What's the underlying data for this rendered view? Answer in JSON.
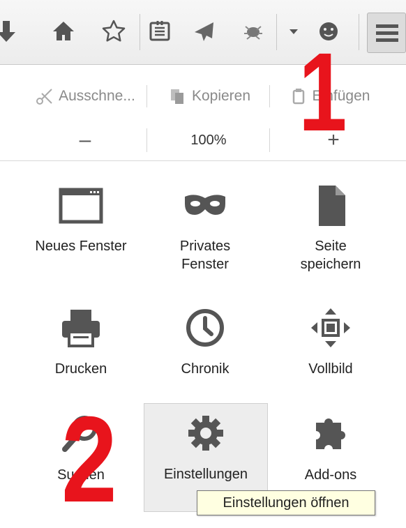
{
  "toolbar": {
    "icons": [
      "download-arrow-icon",
      "home-icon",
      "bookmark-star-icon",
      "reading-list-icon",
      "send-tab-icon",
      "addon-bug-icon",
      "dropdown-arrow-icon",
      "smiley-icon",
      "hamburger-menu-icon"
    ]
  },
  "edit": {
    "cut_label": "Ausschne...",
    "copy_label": "Kopieren",
    "paste_label": "Einfügen"
  },
  "zoom": {
    "minus": "–",
    "value": "100%",
    "plus": "+"
  },
  "grid": {
    "new_window": "Neues Fenster",
    "private_window_line1": "Privates",
    "private_window_line2": "Fenster",
    "save_page_line1": "Seite",
    "save_page_line2": "speichern",
    "print": "Drucken",
    "history": "Chronik",
    "fullscreen": "Vollbild",
    "find": "Suchen",
    "options": "Einstellungen",
    "addons": "Add-ons"
  },
  "tooltip": {
    "text": "Einstellungen öffnen"
  },
  "annotations": {
    "step1": "1",
    "step2": "2"
  },
  "colors": {
    "annotation_red": "#e8141c",
    "toolbar_bg": "#f0f0f0",
    "hover_bg": "#ededed",
    "tooltip_bg": "#ffffe1"
  }
}
